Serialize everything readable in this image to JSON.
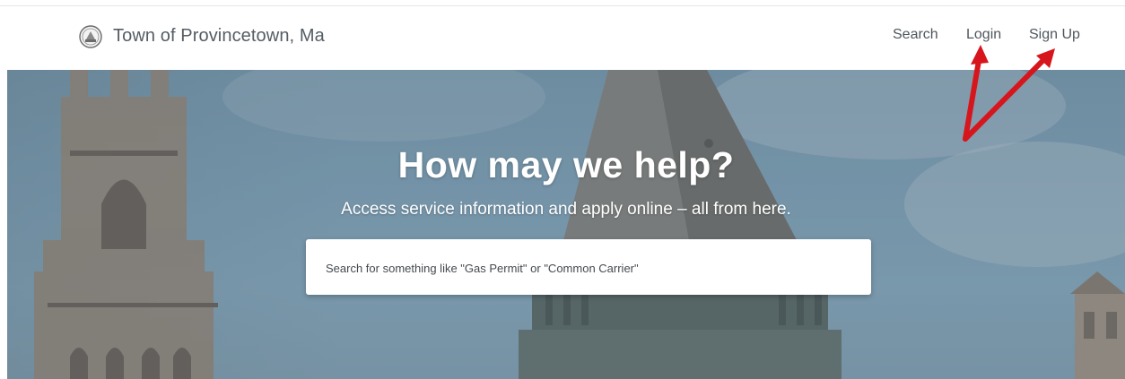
{
  "header": {
    "brand": "Town of Provincetown, Ma",
    "seal_icon": "town-seal-icon",
    "nav": {
      "search": "Search",
      "login": "Login",
      "signup": "Sign Up"
    }
  },
  "hero": {
    "title": "How may we help?",
    "subtitle": "Access service information and apply online – all from here.",
    "search_placeholder": "Search for something like \"Gas Permit\" or \"Common Carrier\""
  },
  "annotations": {
    "arrow_color": "#d6161c",
    "arrow_icon": "red-arrow-icon"
  },
  "colors": {
    "nav_text": "#4f575d",
    "hero_sky": "#86a9bf"
  }
}
